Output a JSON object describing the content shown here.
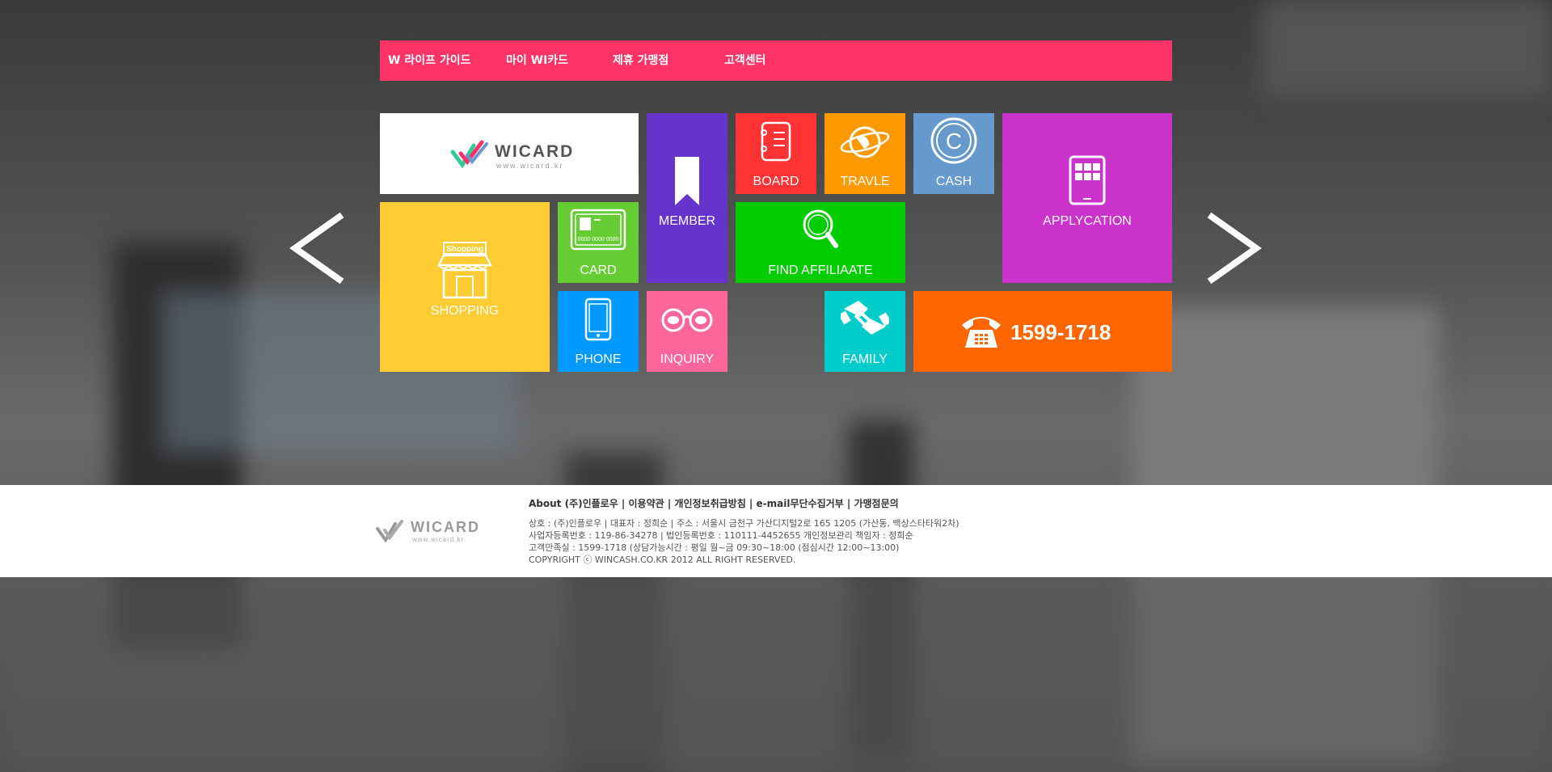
{
  "nav": {
    "items": [
      {
        "label": "W 라이프 가이드"
      },
      {
        "label": "마이 WI카드"
      },
      {
        "label": "제휴 가맹점"
      },
      {
        "label": "고객센터"
      }
    ]
  },
  "logo": {
    "wordmark": "WICARD",
    "url_text": "www.wicard.kr"
  },
  "tiles": {
    "member": "MEMBER",
    "board": "BOARD",
    "travle": "TRAVLE",
    "cash": "CASH",
    "applycation": "APPLYCATION",
    "shopping": "SHOPPING",
    "shopping_sign": "Shopping",
    "card": "CARD",
    "card_number": "0000 0000 0000",
    "find": "FIND AFFILIAATE",
    "phone": "PHONE",
    "inquiry": "INQUIRY",
    "family": "FAMILY",
    "tel": "1599-1718",
    "cash_letter": "C"
  },
  "colors": {
    "nav": "#ff3366",
    "member": "#6633cc",
    "board": "#ff3333",
    "travle": "#ff9900",
    "cash": "#6699cc",
    "applycation": "#cc33cc",
    "shopping": "#ffcc33",
    "card": "#66cc33",
    "find": "#00cc00",
    "phone": "#0099ff",
    "inquiry": "#ff6699",
    "family": "#00cccc",
    "tel": "#ff6600"
  },
  "footer": {
    "links": [
      "About (주)인플로우",
      "이용약관",
      "개인정보취급방침",
      "e-mail무단수집거부",
      "가맹점문의"
    ],
    "separator": " | ",
    "info_lines": [
      "상호 : (주)인플로우 | 대표자 : 정희순 | 주소 : 서울시 금천구 가산디지털2로 165 1205 (가산동, 백상스타타워2차)",
      "사업자등록번호 : 119-86-34278 | 법인등록번호 : 110111-4452655 개인정보관리 책임자 : 정희순",
      "고객만족실 : 1599-1718 (상담가능시간 : 평일 월~금 09:30~18:00 (점심시간 12:00~13:00)",
      "COPYRIGHT ⓒ WINCASH.CO.KR 2012 ALL RIGHT RESERVED."
    ]
  },
  "icons": {
    "prev": "chevron-left-icon",
    "next": "chevron-right-icon",
    "member": "bookmark-icon",
    "board": "notebook-icon",
    "travle": "globe-icon",
    "cash": "coin-icon",
    "applycation": "tablet-icon",
    "shopping": "store-icon",
    "card": "credit-card-icon",
    "find": "magnifier-icon",
    "phone": "smartphone-icon",
    "inquiry": "glasses-icon",
    "family": "handshake-icon",
    "tel": "telephone-icon"
  }
}
